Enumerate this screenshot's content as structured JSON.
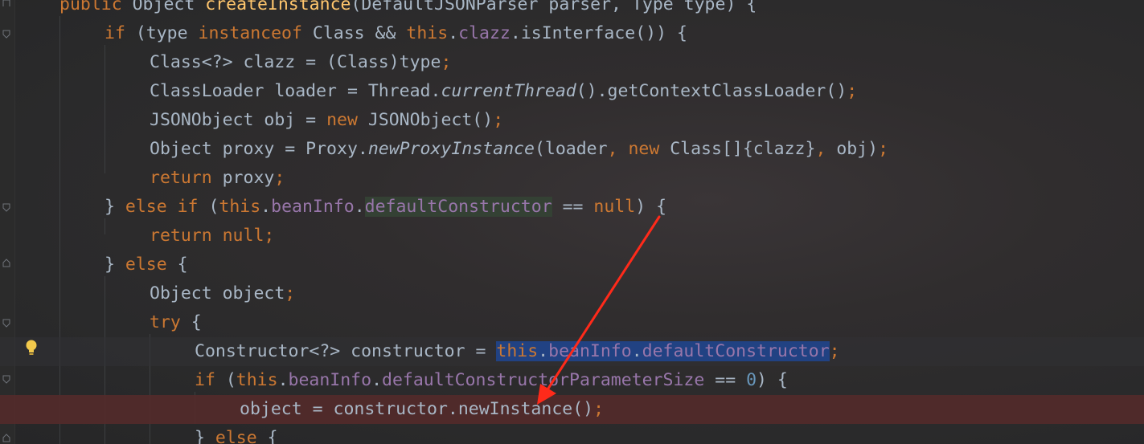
{
  "editor": {
    "language": "Java",
    "colors": {
      "background": "#2b2b2b",
      "plain": "#a9b7c6",
      "keyword": "#cc7832",
      "method_decl": "#ffc66d",
      "field": "#9876aa",
      "number": "#6897bb",
      "breakpoint_line": "#522a2a",
      "selection": "#214283",
      "annotation_arrow": "#ff2a1a"
    },
    "lines": [
      {
        "t": [
          "public",
          " Object ",
          "createInstance",
          "(DefaultJSONParser parser, Type type) {"
        ]
      },
      {
        "t": [
          "if",
          " (type ",
          "instanceof",
          " Class && ",
          "this",
          ".",
          "clazz",
          ".isInterface()) {"
        ]
      },
      {
        "t": [
          "Class<?> clazz = (Class)type",
          ";"
        ]
      },
      {
        "t": [
          "ClassLoader loader = Thread.",
          "currentThread",
          "().getContextClassLoader()",
          ";"
        ]
      },
      {
        "t": [
          "JSONObject obj = ",
          "new",
          " JSONObject()",
          ";"
        ]
      },
      {
        "t": [
          "Object proxy = Proxy.",
          "newProxyInstance",
          "(loader",
          ", ",
          "new",
          " Class[]{clazz}",
          ", ",
          "obj)",
          ";"
        ]
      },
      {
        "t": [
          "return",
          " proxy",
          ";"
        ]
      },
      {
        "t": [
          "} ",
          "else if",
          " (",
          "this",
          ".",
          "beanInfo",
          ".",
          "defaultConstructor",
          " == ",
          "null",
          ") {"
        ]
      },
      {
        "t": [
          "return null",
          ";"
        ]
      },
      {
        "t": [
          "} ",
          "else",
          " {"
        ]
      },
      {
        "t": [
          "Object object",
          ";"
        ]
      },
      {
        "t": [
          "try",
          " {"
        ]
      },
      {
        "t": [
          "Constructor<?> constructor = ",
          "this",
          ".",
          "beanInfo",
          ".",
          "defaultConstructor",
          ";"
        ]
      },
      {
        "t": [
          "if",
          " (",
          "this",
          ".",
          "beanInfo",
          ".",
          "defaultConstructorParameterSize",
          " == ",
          "0",
          ") {"
        ]
      },
      {
        "t": [
          "object = constructor.newInstance()",
          ";"
        ]
      },
      {
        "t": [
          "} ",
          "else",
          " {"
        ]
      }
    ]
  }
}
